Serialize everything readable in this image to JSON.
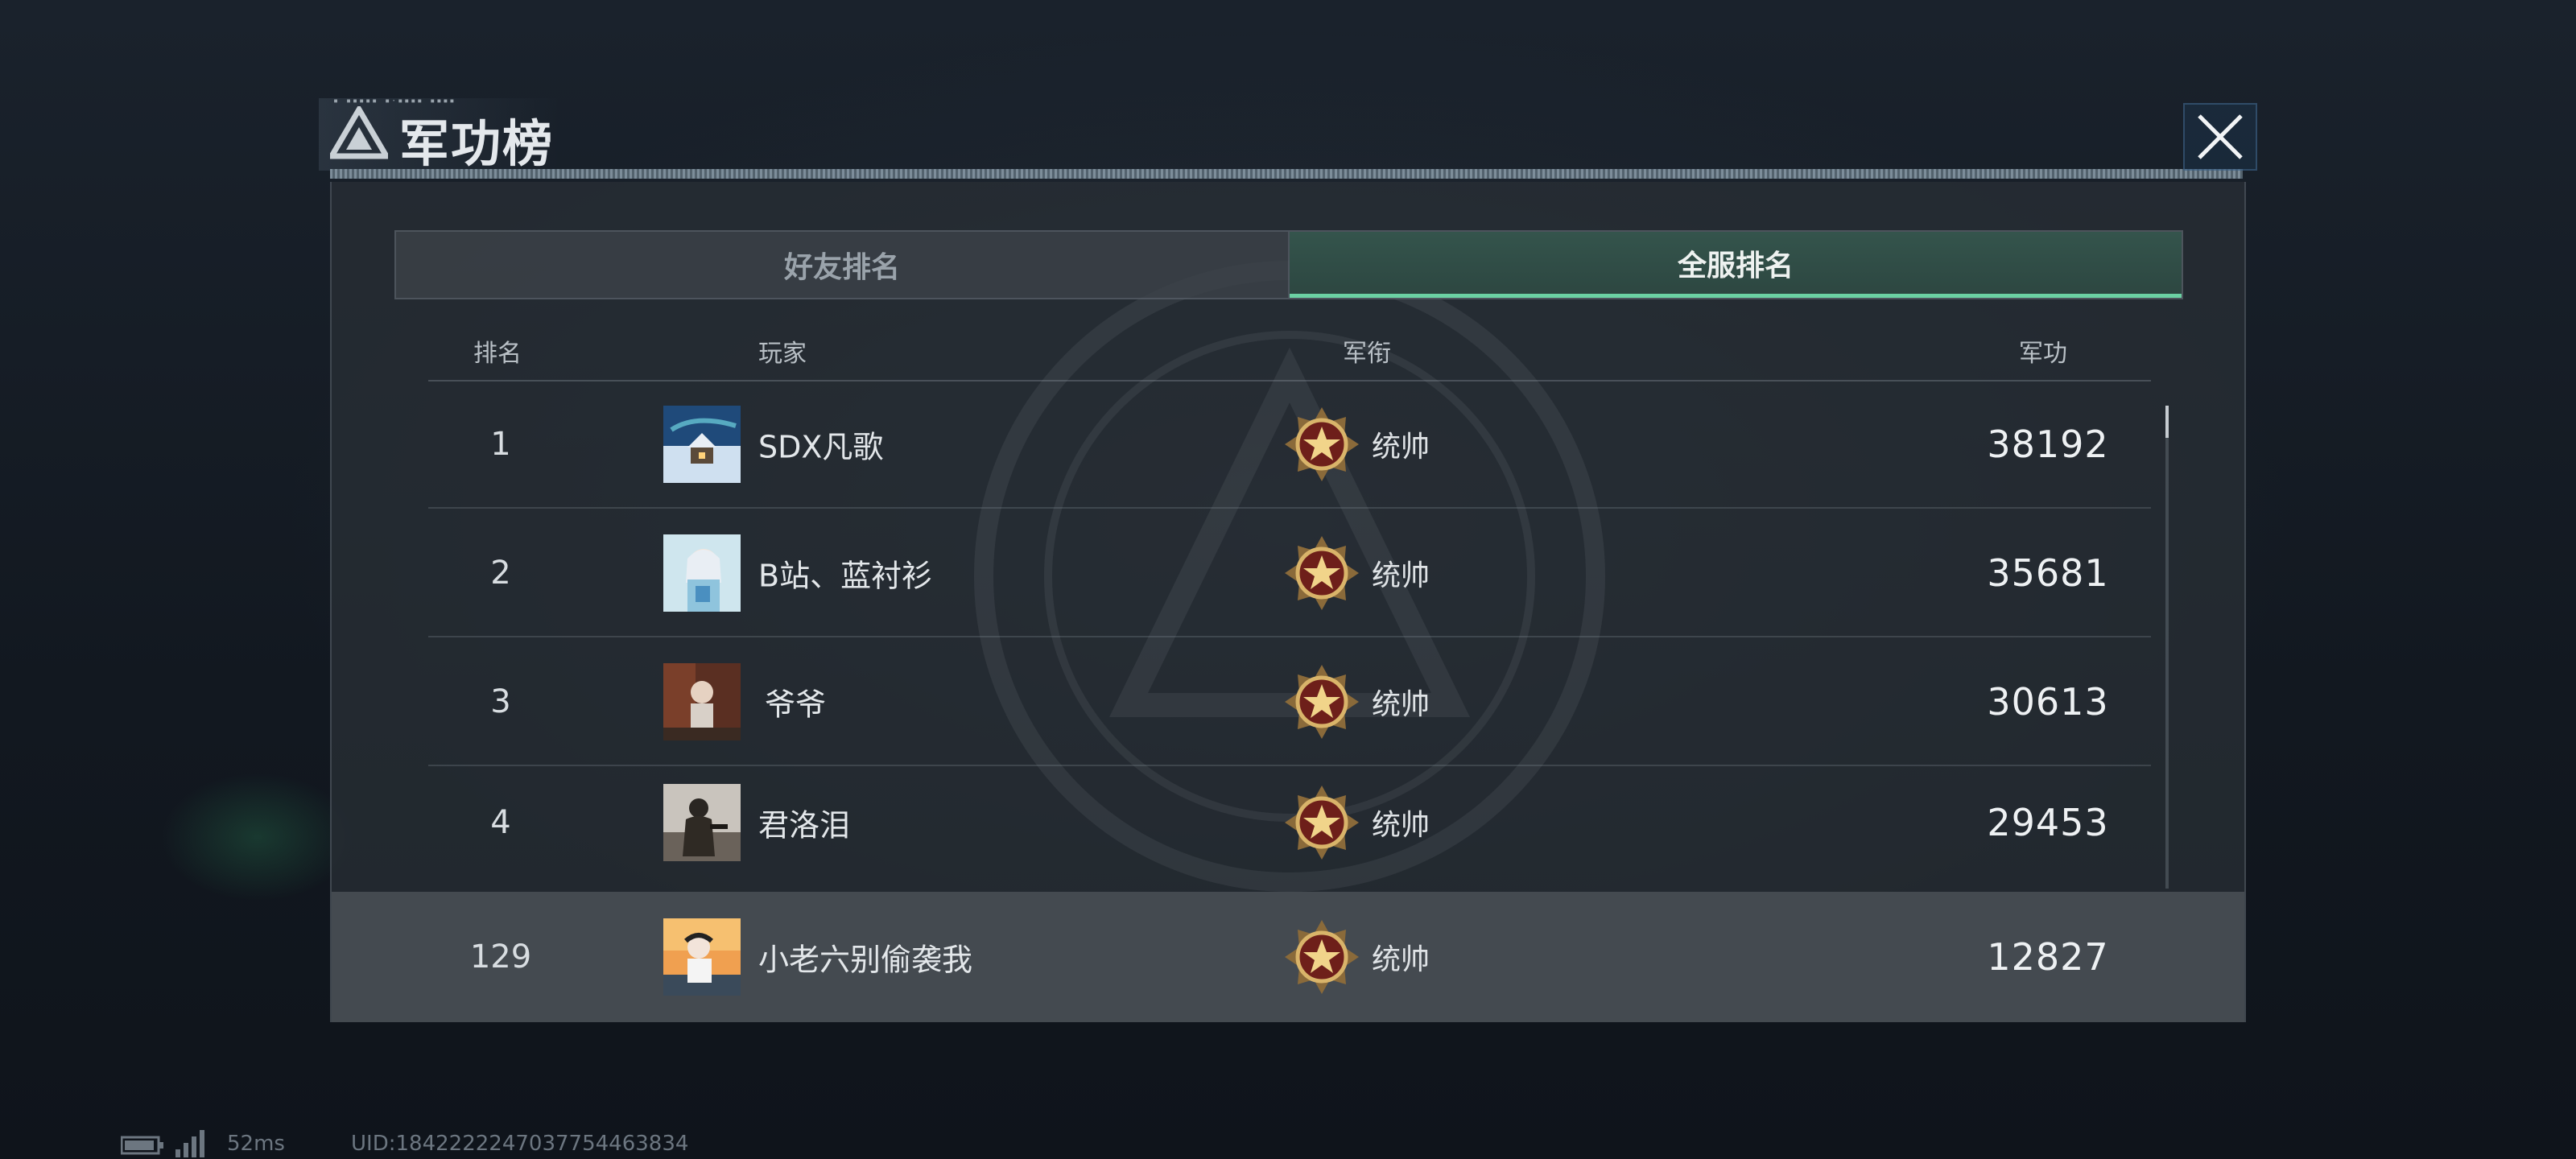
{
  "window": {
    "title": "军功榜",
    "title_tiny": "▪ ▪▪▪▪▪ ▪·▪▪▪▪ ▪▪▪▪"
  },
  "tabs": [
    {
      "label": "好友排名",
      "active": false
    },
    {
      "label": "全服排名",
      "active": true
    }
  ],
  "table": {
    "headers": {
      "rank": "排名",
      "player": "玩家",
      "title": "军衔",
      "merit": "军功"
    },
    "rows": [
      {
        "rank": "1",
        "player": "SDX凡歌",
        "title": "统帅",
        "merit": "38192",
        "avatar": "snowy-cabin-avatar"
      },
      {
        "rank": "2",
        "player": "B站、蓝衬衫",
        "title": "统帅",
        "merit": "35681",
        "avatar": "anime-girl-avatar"
      },
      {
        "rank": "3",
        "player": "爷爷",
        "title": "统帅",
        "merit": "30613",
        "avatar": "portrait-avatar"
      },
      {
        "rank": "4",
        "player": "君洛泪",
        "title": "统帅",
        "merit": "29453",
        "avatar": "soldier-avatar"
      }
    ],
    "self_row": {
      "rank": "129",
      "player": "小老六别偷袭我",
      "title": "统帅",
      "merit": "12827",
      "avatar": "sunset-girl-avatar"
    }
  },
  "status": {
    "ping": "52ms",
    "uid": "UID:1842222247037754463834"
  },
  "colors": {
    "accent": "#6bd1a3",
    "active_tab_bg": "#34544c",
    "panel_bg": "#2b3137"
  }
}
